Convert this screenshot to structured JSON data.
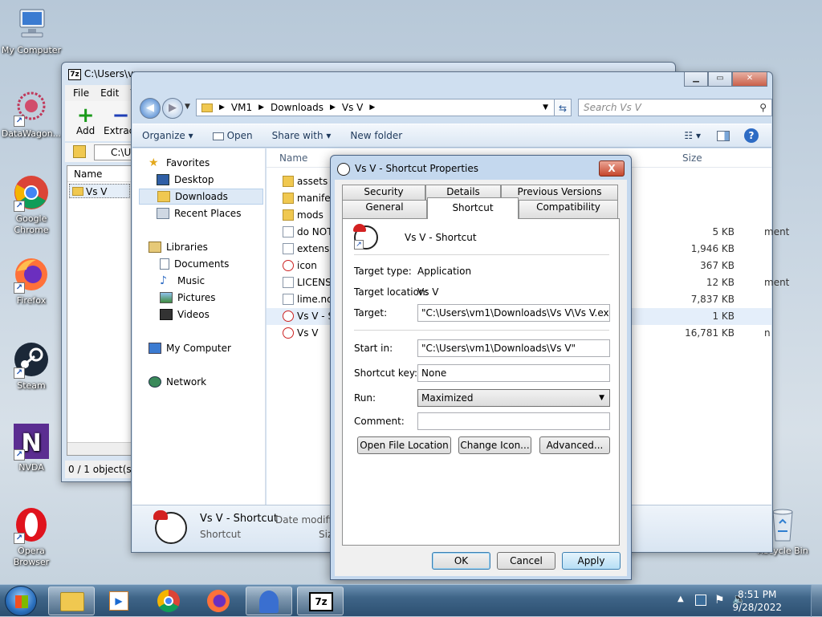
{
  "desktop": {
    "icons": [
      {
        "label": "My Computer"
      },
      {
        "label": "DataWagon..."
      },
      {
        "label": "Google Chrome"
      },
      {
        "label": "Firefox"
      },
      {
        "label": "Steam"
      },
      {
        "label": "NVDA"
      },
      {
        "label": "Opera Browser"
      },
      {
        "label": "Recycle Bin"
      }
    ]
  },
  "sevenzip": {
    "title": "C:\\Users\\vm",
    "menu": [
      "File",
      "Edit",
      "V"
    ],
    "toolbar": {
      "add": "Add",
      "extract": "Extract"
    },
    "path": "C:\\U",
    "column_name": "Name",
    "item": "Vs V",
    "status": "0 / 1 object(s) s"
  },
  "explorer": {
    "breadcrumb": [
      "VM1",
      "Downloads",
      "Vs V"
    ],
    "search_placeholder": "Search Vs V",
    "commands": {
      "organize": "Organize",
      "open": "Open",
      "share_with": "Share with",
      "new_folder": "New folder"
    },
    "nav": {
      "favorites": "Favorites",
      "desktop": "Desktop",
      "downloads": "Downloads",
      "recent": "Recent Places",
      "libraries": "Libraries",
      "documents": "Documents",
      "music": "Music",
      "pictures": "Pictures",
      "videos": "Videos",
      "computer": "My Computer",
      "network": "Network"
    },
    "columns": {
      "name": "Name",
      "size": "Size"
    },
    "files": [
      {
        "name": "assets",
        "type": "",
        "size": ""
      },
      {
        "name": "manifes",
        "type": "",
        "size": ""
      },
      {
        "name": "mods",
        "type": "",
        "size": ""
      },
      {
        "name": "do NOT",
        "type": "ment",
        "size": "5 KB"
      },
      {
        "name": "extensio",
        "type": "",
        "size": "1,946 KB"
      },
      {
        "name": "icon",
        "type": "",
        "size": "367 KB"
      },
      {
        "name": "LICENSE",
        "type": "ment",
        "size": "12 KB"
      },
      {
        "name": "lime.nd",
        "type": "",
        "size": "7,837 KB"
      },
      {
        "name": "Vs V - Sh",
        "type": "",
        "size": "1 KB"
      },
      {
        "name": "Vs V",
        "type": "n",
        "size": "16,781 KB"
      }
    ],
    "details": {
      "name": "Vs V - Shortcut",
      "date_label": "Date modifie",
      "type": "Shortcut",
      "size_label": "Siz"
    }
  },
  "properties": {
    "title": "Vs V - Shortcut Properties",
    "close": "X",
    "tabs_back": [
      "Security",
      "Details",
      "Previous Versions"
    ],
    "tabs_front": [
      "General",
      "Shortcut",
      "Compatibility"
    ],
    "shortcut_name": "Vs V - Shortcut",
    "target_type_label": "Target type:",
    "target_type": "Application",
    "target_location_label": "Target location:",
    "target_location": "Vs V",
    "target_label": "Target:",
    "target": "\"C:\\Users\\vm1\\Downloads\\Vs V\\Vs V.exe\"",
    "start_in_label": "Start in:",
    "start_in": "\"C:\\Users\\vm1\\Downloads\\Vs V\"",
    "shortcut_key_label": "Shortcut key:",
    "shortcut_key": "None",
    "run_label": "Run:",
    "run": "Maximized",
    "comment_label": "Comment:",
    "comment": "",
    "buttons": {
      "open_location": "Open File Location",
      "change_icon": "Change Icon...",
      "advanced": "Advanced...",
      "ok": "OK",
      "cancel": "Cancel",
      "apply": "Apply"
    }
  },
  "taskbar": {
    "time": "8:51 PM",
    "date": "9/28/2022"
  }
}
